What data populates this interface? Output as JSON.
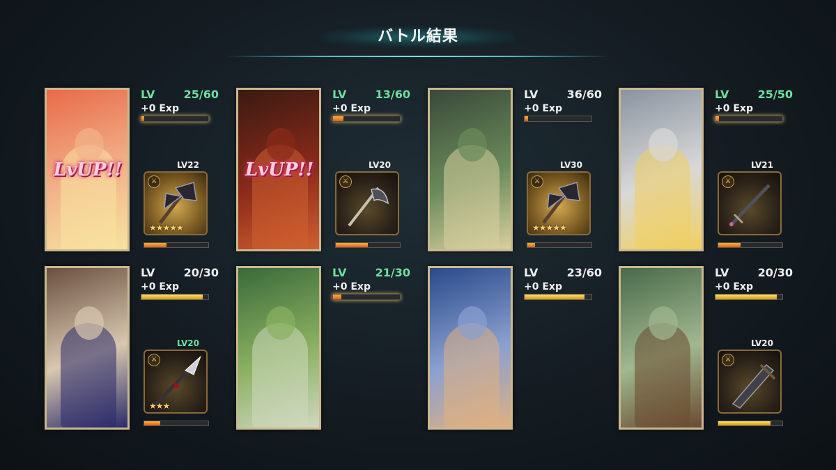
{
  "screen": {
    "title": "バトル結果"
  },
  "units": [
    {
      "lv_label": "LV",
      "lv": "25/60",
      "lv_color": "green",
      "exp": "+0 Exp",
      "exp_fill": 0.04,
      "lvup": "LvUP!!",
      "portrait_colors": [
        "#e86a4a",
        "#f2b38a",
        "#f7e3a0"
      ],
      "has_weapon": true,
      "weapon_lv": "LV22",
      "weapon_lv_color": "white",
      "weapon_icon": "battle-axe-icon",
      "weapon_golden": true,
      "weapon_stars": "★★★★★",
      "weapon_fill": 0.35,
      "weapon_bar": "orange"
    },
    {
      "lv_label": "LV",
      "lv": "13/60",
      "lv_color": "green",
      "exp": "+0 Exp",
      "exp_fill": 0.16,
      "lvup": "LvUP!!",
      "portrait_colors": [
        "#3a1a12",
        "#8a2a1a",
        "#d06030"
      ],
      "has_weapon": true,
      "weapon_lv": "LV20",
      "weapon_lv_color": "white",
      "weapon_icon": "axe-icon",
      "weapon_golden": false,
      "weapon_stars": "",
      "weapon_fill": 0.5,
      "weapon_bar": "orange"
    },
    {
      "lv_label": "LV",
      "lv": "36/60",
      "lv_color": "white",
      "exp": "+0 Exp",
      "exp_fill": 0.05,
      "lvup": "",
      "portrait_colors": [
        "#3a4a3a",
        "#6a8a5a",
        "#d8d0a0"
      ],
      "has_weapon": true,
      "weapon_lv": "LV30",
      "weapon_lv_color": "white",
      "weapon_icon": "battle-axe-icon",
      "weapon_golden": true,
      "weapon_stars": "★★★★★",
      "weapon_fill": 0.12,
      "weapon_bar": "orange"
    },
    {
      "lv_label": "LV",
      "lv": "25/50",
      "lv_color": "green",
      "exp": "+0 Exp",
      "exp_fill": 0.05,
      "lvup": "",
      "portrait_colors": [
        "#8a94a0",
        "#d8d8d8",
        "#f0d060"
      ],
      "has_weapon": true,
      "weapon_lv": "LV21",
      "weapon_lv_color": "white",
      "weapon_icon": "sword-icon",
      "weapon_golden": false,
      "weapon_stars": "",
      "weapon_fill": 0.35,
      "weapon_bar": "orange"
    },
    {
      "lv_label": "LV",
      "lv": "20/30",
      "lv_color": "white",
      "exp": "+0 Exp",
      "exp_fill": 0.92,
      "lvup": "",
      "portrait_colors": [
        "#6a5040",
        "#d8c8b0",
        "#2a2a6a"
      ],
      "has_weapon": true,
      "weapon_lv": "LV20",
      "weapon_lv_color": "green",
      "weapon_icon": "spear-icon",
      "weapon_golden": false,
      "weapon_stars": "★★★",
      "weapon_fill": 0.25,
      "weapon_bar": "orange"
    },
    {
      "lv_label": "LV",
      "lv": "21/30",
      "lv_color": "green",
      "exp": "+0 Exp",
      "exp_fill": 0.12,
      "lvup": "",
      "portrait_colors": [
        "#3a6a3a",
        "#8ab060",
        "#d0d8c0"
      ],
      "has_weapon": false
    },
    {
      "lv_label": "LV",
      "lv": "23/60",
      "lv_color": "white",
      "exp": "+0 Exp",
      "exp_fill": 0.9,
      "lvup": "",
      "portrait_colors": [
        "#2a4a8a",
        "#8aa0d0",
        "#e0b080"
      ],
      "has_weapon": false
    },
    {
      "lv_label": "LV",
      "lv": "20/30",
      "lv_color": "white",
      "exp": "+0 Exp",
      "exp_fill": 0.92,
      "lvup": "",
      "portrait_colors": [
        "#4a6a4a",
        "#a0b890",
        "#6a4a30"
      ],
      "has_weapon": true,
      "weapon_lv": "LV20",
      "weapon_lv_color": "white",
      "weapon_icon": "greatsword-icon",
      "weapon_golden": false,
      "weapon_stars": "",
      "weapon_fill": 0.82,
      "weapon_bar": "gold"
    }
  ]
}
